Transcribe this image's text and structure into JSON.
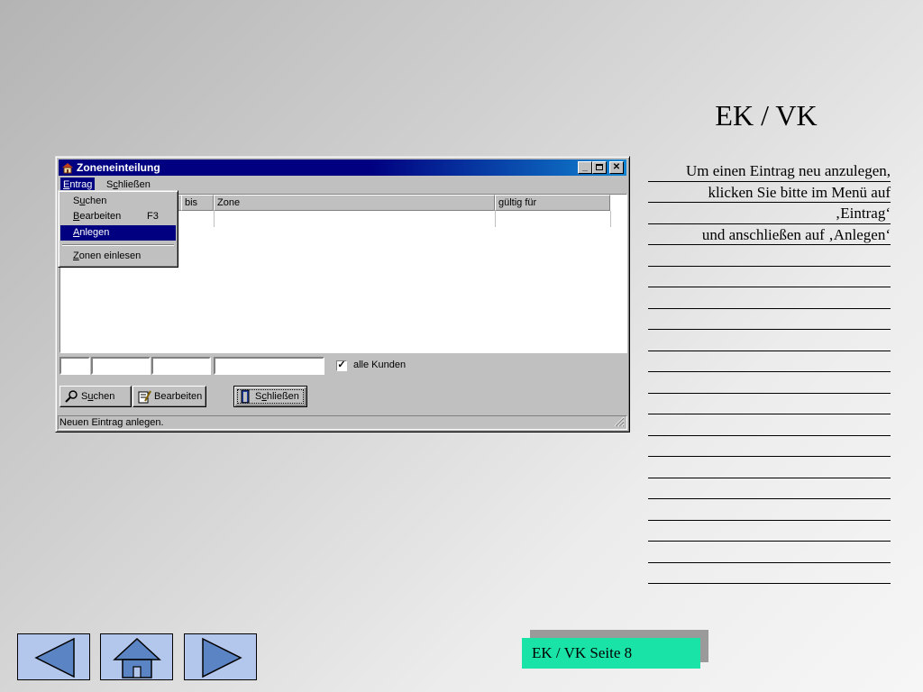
{
  "slide": {
    "title": "EK / VK",
    "page_label": "EK / VK Seite 8"
  },
  "notes": {
    "lines": [
      "Um einen Eintrag neu anzulegen,",
      "klicken Sie bitte im Menü auf",
      "‚Eintrag‘",
      "und anschließen auf ‚Anlegen‘",
      "",
      "",
      "",
      "",
      "",
      "",
      "",
      "",
      "",
      "",
      "",
      "",
      "",
      "",
      "",
      ""
    ]
  },
  "window": {
    "title": "Zoneneinteilung",
    "menu": [
      {
        "label": "Eintrag",
        "accel": "E"
      },
      {
        "label": "Schließen",
        "accel": "c"
      }
    ],
    "dropdown": [
      {
        "label": "Suchen",
        "shortcut": ""
      },
      {
        "label": "Bearbeiten",
        "shortcut": "F3"
      },
      {
        "label": "Anlegen",
        "shortcut": ""
      },
      {
        "label": "Zonen einlesen",
        "shortcut": ""
      }
    ],
    "columns": [
      "bis",
      "Zone",
      "gültig für"
    ],
    "checkbox": {
      "label": "alle Kunden",
      "checked": true
    },
    "buttons": {
      "search": "Suchen",
      "edit": "Bearbeiten",
      "close": "Schließen"
    },
    "status": "Neuen Eintrag anlegen."
  },
  "nav": {
    "back_icon": "left-triangle",
    "home_icon": "house",
    "forward_icon": "right-triangle",
    "button_color": "#b3c7ec",
    "icon_color": "#5b84c4"
  },
  "colors": {
    "titlebar": "#000080",
    "selection": "#000080",
    "page_label_bg": "#19e3a6"
  }
}
